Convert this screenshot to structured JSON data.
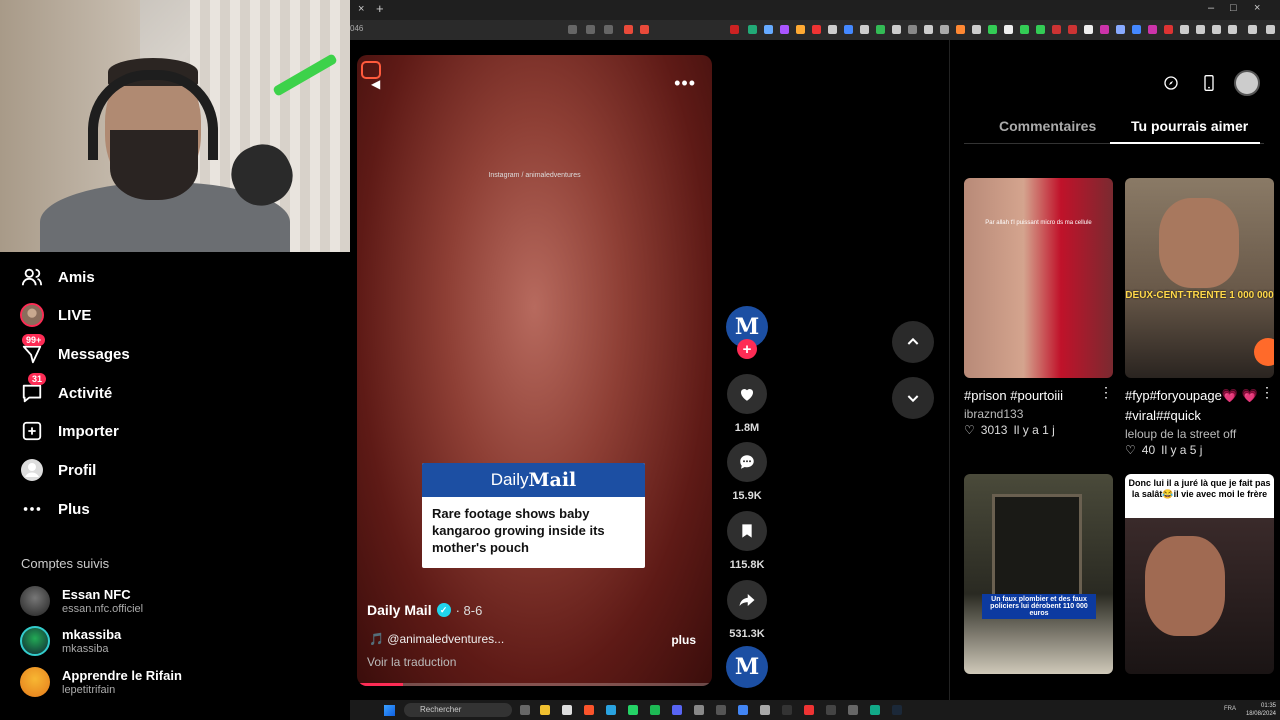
{
  "browser": {
    "url_fragment": "046",
    "tab_close": "×",
    "tab_new": "+",
    "win_min": "–",
    "win_max": "□",
    "win_close": "×"
  },
  "sidebar": {
    "nav": [
      {
        "label": "Amis",
        "icon": "friends-icon"
      },
      {
        "label": "LIVE",
        "icon": "live-icon"
      },
      {
        "label": "Messages",
        "icon": "messages-icon",
        "badge": "99+"
      },
      {
        "label": "Activité",
        "icon": "activity-icon",
        "badge": "31"
      },
      {
        "label": "Importer",
        "icon": "upload-icon"
      },
      {
        "label": "Profil",
        "icon": "profile-icon"
      },
      {
        "label": "Plus",
        "icon": "more-icon"
      }
    ],
    "following_title": "Comptes suivis",
    "accounts": [
      {
        "name": "Essan NFC",
        "username": "essan.nfc.officiel"
      },
      {
        "name": "mkassiba",
        "username": "mkassiba"
      },
      {
        "name": "Apprendre le Rifain",
        "username": "lepetitrifain"
      }
    ]
  },
  "video": {
    "watermark": "Instagram / animaledventures",
    "more": "•••",
    "card": {
      "brand_light": "Daily",
      "brand_bold": "Mail",
      "headline": "Rare footage shows baby kangaroo growing inside its mother's pouch"
    },
    "author": "Daily Mail",
    "verified": "✓",
    "date": "· 8-6",
    "music": "🎵 @animaledventures...",
    "more_label": "plus",
    "translate": "Voir la traduction",
    "progress": 0.13
  },
  "actions": {
    "avatar_letter": "M",
    "follow": "+",
    "like_count": "1.8M",
    "comment_count": "15.9K",
    "save_count": "115.8K",
    "share_count": "531.3K"
  },
  "nav_arrows": {
    "up": "⌃",
    "down": "⌄"
  },
  "right_panel": {
    "tabs": {
      "comments": "Commentaires",
      "suggested": "Tu pourrais aimer"
    },
    "cards": [
      {
        "caption": "#prison #pourtoiii",
        "user": "ibraznd133",
        "likes": "3013",
        "time": "Il y a 1 j",
        "overlay": "Par allah t'l puissant micro ds ma cellule"
      },
      {
        "caption": "#fyp#foryoupage💗 💗#viral##quick",
        "user": "leloup de la street off",
        "likes": "40",
        "time": "Il y a 5 j",
        "overlay": "DEUX-CENT-TRENTE 1 000 000"
      },
      {
        "caption": "",
        "user": "",
        "likes": "",
        "time": "",
        "overlay": "Un faux plombier et des faux policiers lui dérobent 110 000 euros"
      },
      {
        "caption": "",
        "user": "",
        "likes": "",
        "time": "",
        "overlay": "Donc lui il a juré là que je fait pas la salât😂il vie avec moi le frère"
      }
    ]
  },
  "taskbar": {
    "search": "Rechercher",
    "lang": "FRA",
    "time": "01:35",
    "date": "18/08/2024"
  },
  "colors": {
    "accent": "#fe2c55",
    "dailymail_blue": "#1c4fa3",
    "verified": "#20d5ec"
  }
}
